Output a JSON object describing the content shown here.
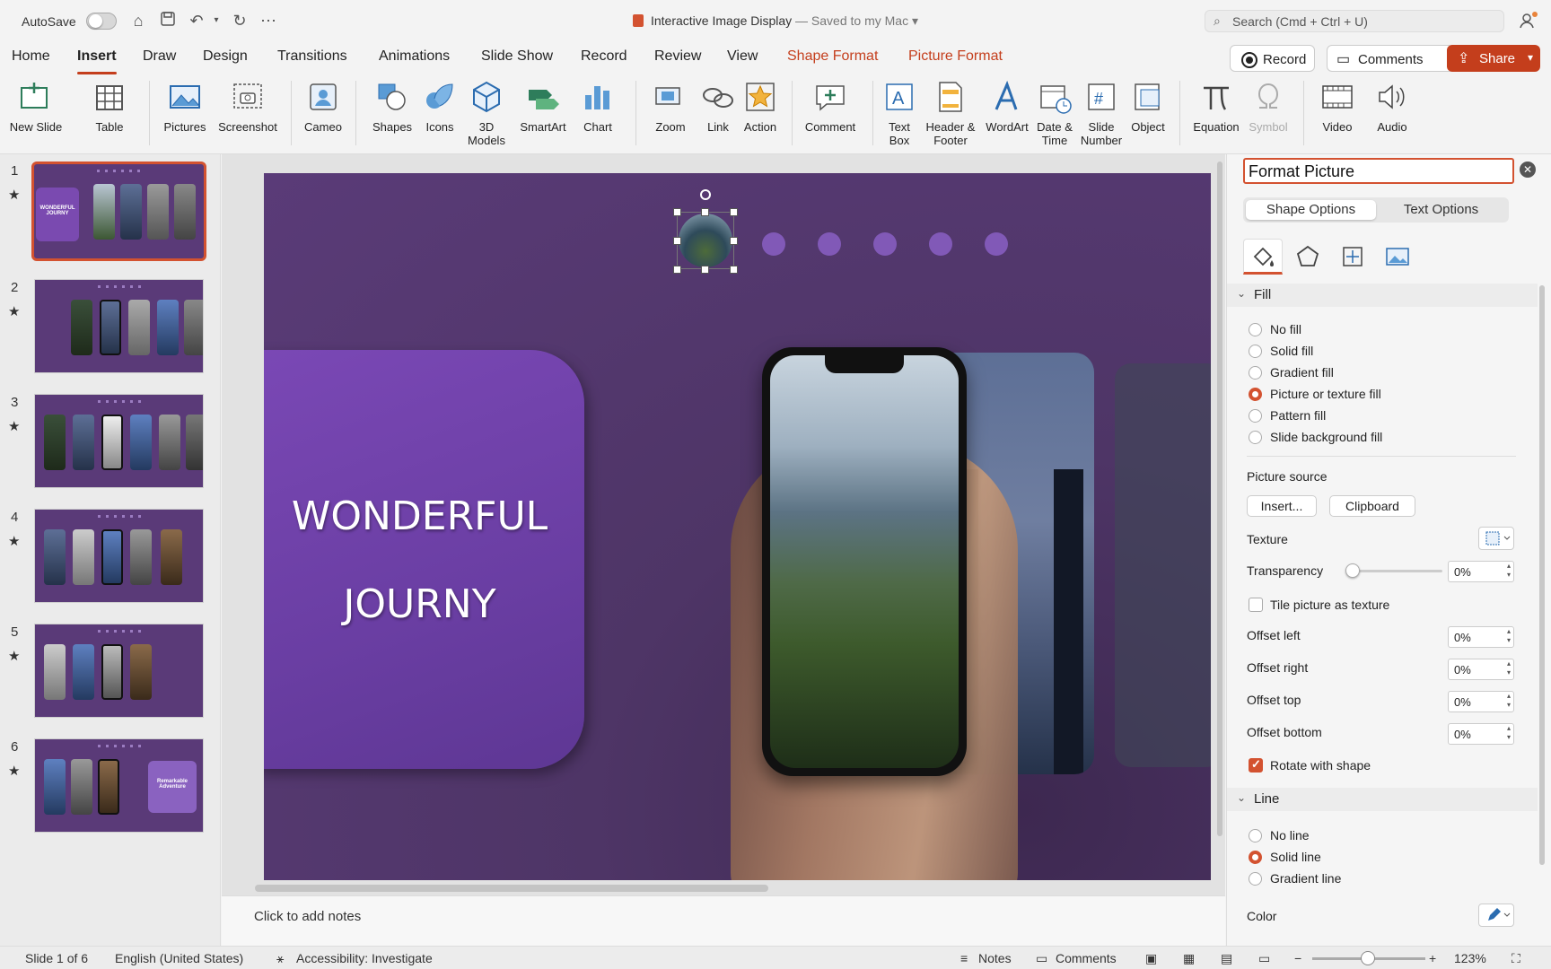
{
  "app": {
    "autosave_label": "AutoSave",
    "doc_title": "Interactive Image Display",
    "save_status": "— Saved to my Mac",
    "search_placeholder": "Search (Cmd + Ctrl + U)"
  },
  "ribbon": {
    "tabs": [
      "Home",
      "Insert",
      "Draw",
      "Design",
      "Transitions",
      "Animations",
      "Slide Show",
      "Record",
      "Review",
      "View",
      "Shape Format",
      "Picture Format"
    ],
    "active_tab": "Insert",
    "record_label": "Record",
    "comments_label": "Comments",
    "share_label": "Share",
    "tools": {
      "new_slide": "New Slide",
      "table": "Table",
      "pictures": "Pictures",
      "screenshot": "Screenshot",
      "cameo": "Cameo",
      "shapes": "Shapes",
      "icons": "Icons",
      "models_3d": "3D Models",
      "smartart": "SmartArt",
      "chart": "Chart",
      "zoom": "Zoom",
      "link": "Link",
      "action": "Action",
      "comment": "Comment",
      "text_box": "Text Box",
      "header_footer": "Header & Footer",
      "wordart": "WordArt",
      "date_time": "Date & Time",
      "slide_number": "Slide Number",
      "object": "Object",
      "equation": "Equation",
      "symbol": "Symbol",
      "video": "Video",
      "audio": "Audio"
    }
  },
  "slides": {
    "numbers": [
      "1",
      "2",
      "3",
      "4",
      "5",
      "6"
    ],
    "star": "★",
    "thumb1_text": "WONDERFUL JOURNY",
    "thumb6_text": "Remarkable Adventure"
  },
  "slide": {
    "title_line1": "WONDERFUL",
    "title_line2": "JOURNY"
  },
  "notes_placeholder": "Click to add notes",
  "panel": {
    "title": "Format Picture",
    "seg_shape": "Shape Options",
    "seg_text": "Text Options",
    "fill_header": "Fill",
    "fill_options": [
      "No fill",
      "Solid fill",
      "Gradient fill",
      "Picture or texture fill",
      "Pattern fill",
      "Slide background fill"
    ],
    "fill_selected": 3,
    "picture_source": "Picture source",
    "insert_btn": "Insert...",
    "clipboard_btn": "Clipboard",
    "texture": "Texture",
    "transparency": "Transparency",
    "transparency_value": "0%",
    "tile_label": "Tile picture as texture",
    "offset_left": "Offset left",
    "offset_right": "Offset right",
    "offset_top": "Offset top",
    "offset_bottom": "Offset bottom",
    "offset_left_value": "0%",
    "offset_right_value": "0%",
    "offset_top_value": "0%",
    "offset_bottom_value": "0%",
    "rotate_label": "Rotate with shape",
    "line_header": "Line",
    "line_options": [
      "No line",
      "Solid line",
      "Gradient line"
    ],
    "line_selected": 1,
    "color_label": "Color"
  },
  "status": {
    "slide_pos": "Slide 1 of 6",
    "language": "English (United States)",
    "accessibility": "Accessibility: Investigate",
    "notes": "Notes",
    "comments": "Comments",
    "zoom": "123%"
  },
  "colors": {
    "accent": "#c43e1c",
    "slide_bg": "#5a3b78",
    "title_box": "#6a3ea3"
  }
}
